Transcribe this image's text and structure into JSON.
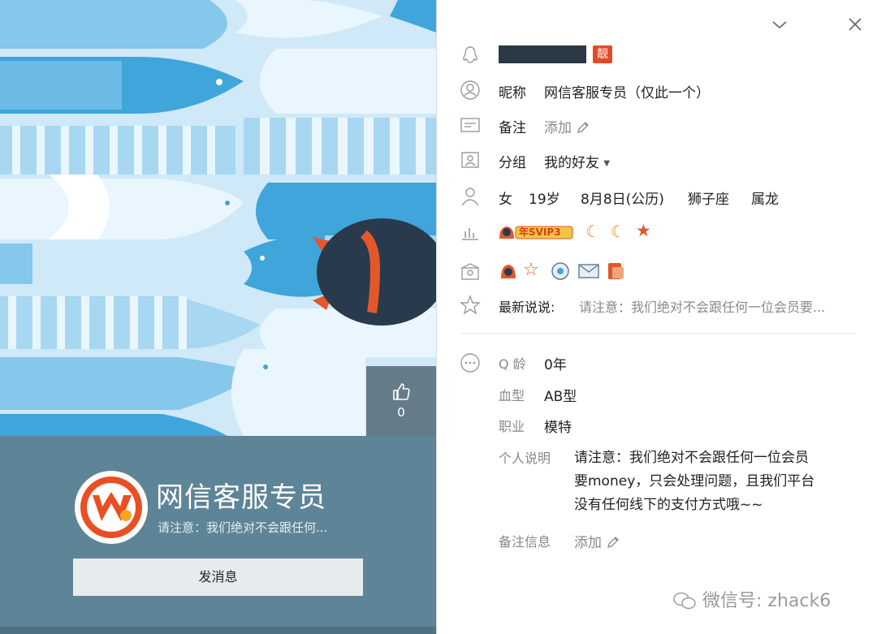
{
  "window": {
    "minimize_icon": "chevron-down-icon",
    "close_icon": "close-icon"
  },
  "profile": {
    "name": "网信客服专员",
    "signature": "请注意：我们绝对不会跟任何...",
    "send_button": "发消息",
    "like_count": "0"
  },
  "info": {
    "liang_badge": "靓",
    "nickname_label": "昵称",
    "nickname_value": "网信客服专员（仅此一个）",
    "remark_label": "备注",
    "remark_value": "添加",
    "group_label": "分组",
    "group_value": "我的好友",
    "gender": "女",
    "age": "19岁",
    "birthday": "8月8日(公历)",
    "zodiac": "狮子座",
    "chinese_zodiac": "属龙",
    "vip_text": "年SVIP3",
    "latest_label": "最新说说:",
    "latest_value": "请注意：我们绝对不会跟任何一位会员要..."
  },
  "details": {
    "qage_label": "Q 龄",
    "qage_value": "0年",
    "blood_label": "血型",
    "blood_value": "AB型",
    "job_label": "职业",
    "job_value": "模特",
    "bio_label": "个人说明",
    "bio_lines": [
      "请注意：我们绝对不会跟任何一位会员",
      "要money，只会处理问题，且我们平台",
      "没有任何线下的支付方式哦~~"
    ],
    "remark_info_label": "备注信息",
    "remark_info_value": "添加"
  },
  "watermark": "微信号: zhack6",
  "colors": {
    "accent_blue": "#2f6fb3",
    "profile_bg": "#5e8597",
    "fish_blue": "#3fa5da",
    "liang_red": "#e24a27"
  }
}
